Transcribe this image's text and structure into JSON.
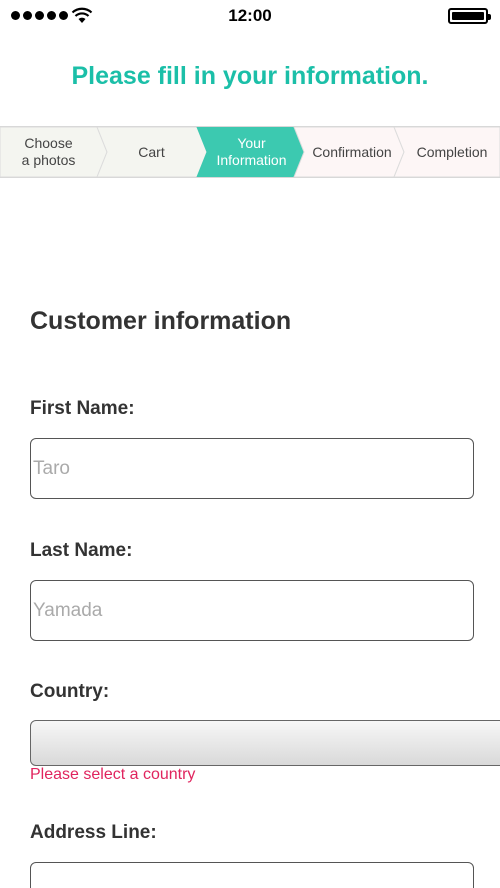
{
  "status_bar": {
    "time": "12:00",
    "signal_icon": "signal-dots-icon",
    "wifi_icon": "wifi-icon",
    "battery_icon": "battery-icon",
    "battery_level": 1.0
  },
  "header": {
    "title": "Please fill in your information.",
    "title_color": "#1bbfa8"
  },
  "stepper": {
    "steps": [
      {
        "line1": "Choose",
        "line2": "a photos",
        "active": false
      },
      {
        "line1": "Cart",
        "line2": "",
        "active": false
      },
      {
        "line1": "Your",
        "line2": "Information",
        "active": true
      },
      {
        "line1": "Confirmation",
        "line2": "",
        "active": false
      },
      {
        "line1": "Completion",
        "line2": "",
        "active": false
      }
    ],
    "active_color": "#3cc9b0",
    "done_color": "#f4f5f0",
    "pending_color": "#fdf6f6"
  },
  "form": {
    "section_title": "Customer information",
    "first_name": {
      "label": "First Name:",
      "value": "",
      "placeholder": "Taro"
    },
    "last_name": {
      "label": "Last Name:",
      "value": "",
      "placeholder": "Yamada"
    },
    "country": {
      "label": "Country:",
      "selected": "",
      "error": "Please select a country",
      "error_color": "#e0245e"
    },
    "address_line": {
      "label": "Address Line:",
      "value": "",
      "placeholder": ""
    }
  }
}
